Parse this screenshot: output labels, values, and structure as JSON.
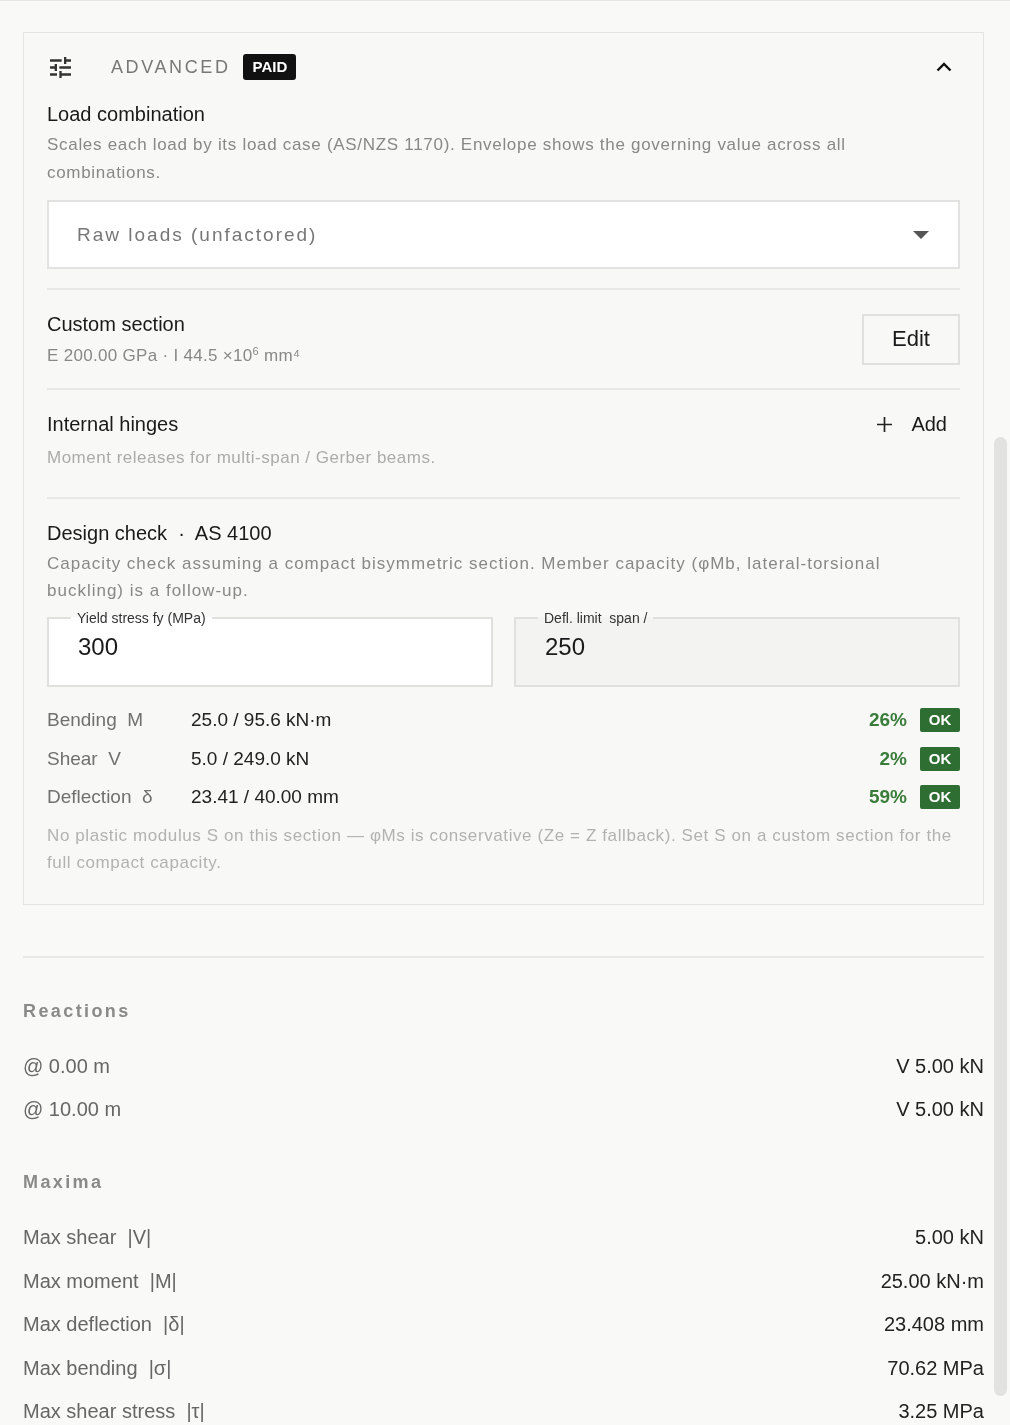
{
  "panel": {
    "title": "ADVANCED",
    "badge": "PAID",
    "expanded": true,
    "load_combination": {
      "title": "Load combination",
      "description": "Scales each load by its load case (AS/NZS 1170). Envelope shows the governing value across all combinations.",
      "select": {
        "value": "Raw loads (unfactored)"
      }
    },
    "custom_section": {
      "title": "Custom section",
      "details": "E 200.00 GPa · I 44.5 ×10$^{6}$ mm⁴",
      "button": "Edit"
    },
    "internal_hinges": {
      "title": "Internal hinges",
      "description": "Moment releases for multi-span / Gerber beams.",
      "button": "Add"
    },
    "design_check": {
      "title": "Design check  ·  AS 4100",
      "description": "Capacity check assuming a compact bisymmetric section. Member capacity (φMb, lateral-torsional buckling) is a follow-up.",
      "fields": [
        {
          "label": "Yield stress fy (MPa)",
          "value": "300",
          "readonly": false
        },
        {
          "label": "Defl. limit  span /",
          "value": "250",
          "readonly": true
        }
      ],
      "checks": [
        {
          "label": "Bending  M",
          "value": "25.0 / 95.6 kN·m",
          "percent": "26%",
          "status": "OK",
          "pass": true
        },
        {
          "label": "Shear  V",
          "value": "5.0 / 249.0 kN",
          "percent": "2%",
          "status": "OK",
          "pass": true
        },
        {
          "label": "Deflection  δ",
          "value": "23.41 / 40.00 mm",
          "percent": "59%",
          "status": "OK",
          "pass": true
        }
      ],
      "note": "No plastic modulus S on this section — φMs is conservative (Ze = Z fallback). Set S on a custom section for the full compact capacity."
    }
  },
  "reactions": {
    "title": "Reactions",
    "rows": [
      {
        "label": "@ 0.00 m",
        "value": "V 5.00 kN"
      },
      {
        "label": "@ 10.00 m",
        "value": "V 5.00 kN"
      }
    ]
  },
  "maxima": {
    "title": "Maxima",
    "rows": [
      {
        "label": "Max shear  |V|",
        "value": "5.00 kN"
      },
      {
        "label": "Max moment  |M|",
        "value": "25.00 kN·m"
      },
      {
        "label": "Max deflection  |δ|",
        "value": "23.408 mm"
      },
      {
        "label": "Max bending  |σ|",
        "value": "70.62 MPa"
      },
      {
        "label": "Max shear stress  |τ|",
        "value": "3.25 MPa"
      }
    ]
  }
}
